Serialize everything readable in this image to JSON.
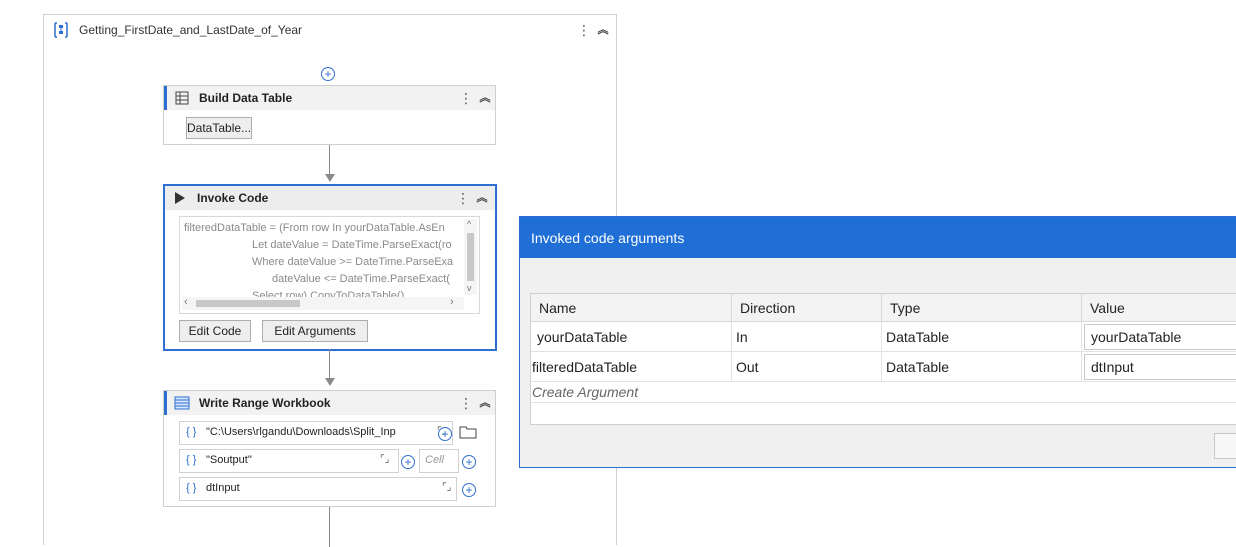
{
  "sequence": {
    "title": "Getting_FirstDate_and_LastDate_of_Year"
  },
  "activities": {
    "build_data_table": {
      "title": "Build Data Table",
      "button_label": "DataTable..."
    },
    "invoke_code": {
      "title": "Invoke Code",
      "code_lines": [
        "filteredDataTable = (From row In yourDataTable.AsEn",
        "Let dateValue = DateTime.ParseExact(ro",
        "Where dateValue >= DateTime.ParseExa",
        "dateValue <= DateTime.ParseExact(",
        "Select row).CopyToDataTable()"
      ],
      "edit_code_label": "Edit Code",
      "edit_arguments_label": "Edit Arguments"
    },
    "write_range": {
      "title": "Write Range Workbook",
      "workbook_path": "\"C:\\Users\\rlgandu\\Downloads\\Split_Inp",
      "sheet_name": "\"Soutput\"",
      "cell_placeholder": "Cell",
      "datatable": "dtInput"
    }
  },
  "dialog": {
    "title": "Invoked code arguments",
    "columns": [
      "Name",
      "Direction",
      "Type",
      "Value"
    ],
    "rows": [
      {
        "name": "yourDataTable",
        "direction": "In",
        "type": "DataTable",
        "value": "yourDataTable"
      },
      {
        "name": "filteredDataTable",
        "direction": "Out",
        "type": "DataTable",
        "value": "dtInput"
      }
    ],
    "create_argument": "Create Argument"
  },
  "icons": {
    "sequence": "sequence-icon",
    "build_table": "table-icon",
    "invoke": "play-icon",
    "write_range": "spreadsheet-icon",
    "add": "plus-circle-icon",
    "kebab": "kebab-menu-icon",
    "collapse": "chevron-double-up-icon"
  },
  "colors": {
    "accent": "#1f6fd6",
    "selected_border": "#2f6fd1"
  }
}
